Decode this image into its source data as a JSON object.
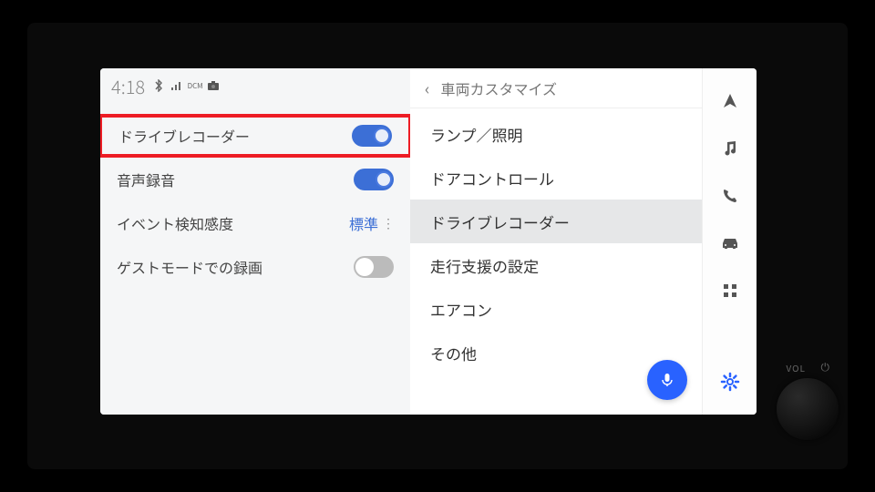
{
  "status": {
    "time": "4:18",
    "icons": [
      "bluetooth",
      "signal",
      "camera"
    ]
  },
  "settings": {
    "rows": [
      {
        "label": "ドライブレコーダー",
        "control": "toggle",
        "on": true,
        "highlighted": true
      },
      {
        "label": "音声録音",
        "control": "toggle",
        "on": true
      },
      {
        "label": "イベント検知感度",
        "control": "value",
        "value": "標準"
      },
      {
        "label": "ゲストモードでの録画",
        "control": "toggle",
        "on": false
      }
    ]
  },
  "panel": {
    "title": "車両カスタマイズ",
    "items": [
      {
        "label": "ランプ／照明",
        "selected": false
      },
      {
        "label": "ドアコントロール",
        "selected": false
      },
      {
        "label": "ドライブレコーダー",
        "selected": true
      },
      {
        "label": "走行支援の設定",
        "selected": false
      },
      {
        "label": "エアコン",
        "selected": false
      },
      {
        "label": "その他",
        "selected": false
      }
    ]
  },
  "sidebar": {
    "items": [
      "navigate",
      "music",
      "phone",
      "car",
      "apps",
      "settings"
    ],
    "active": "settings"
  },
  "hardware": {
    "vol_label": "VOL"
  }
}
